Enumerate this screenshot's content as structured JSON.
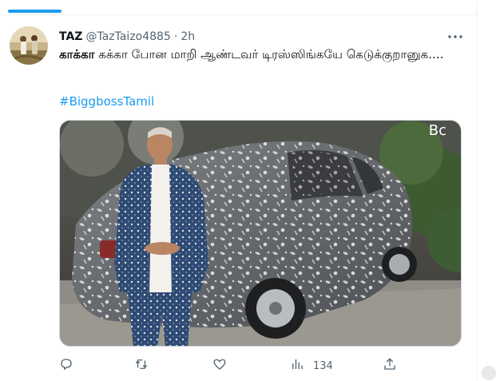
{
  "tweet": {
    "author": {
      "name": "TAZ",
      "handle": "@TazTaizo4885",
      "separator": "·",
      "time": "2h"
    },
    "text_bold": "காக்கா",
    "text_rest": " கக்கா போன மாறி ஆண்டவர் டிரஸ்ஸிங்கயே கெடுக்குறானுக....",
    "hashtag": "#BiggbossTamil",
    "media": {
      "watermark": "Bc"
    },
    "actions": {
      "reply": {
        "icon": "reply-icon"
      },
      "retweet": {
        "icon": "retweet-icon"
      },
      "like": {
        "icon": "heart-icon"
      },
      "views": {
        "icon": "views-icon",
        "count": "134"
      },
      "share": {
        "icon": "share-icon"
      }
    },
    "more_icon": "more-icon"
  },
  "colors": {
    "accent": "#1d9bf0",
    "text_primary": "#0f1419",
    "text_secondary": "#536471",
    "border": "#eff3f4"
  }
}
